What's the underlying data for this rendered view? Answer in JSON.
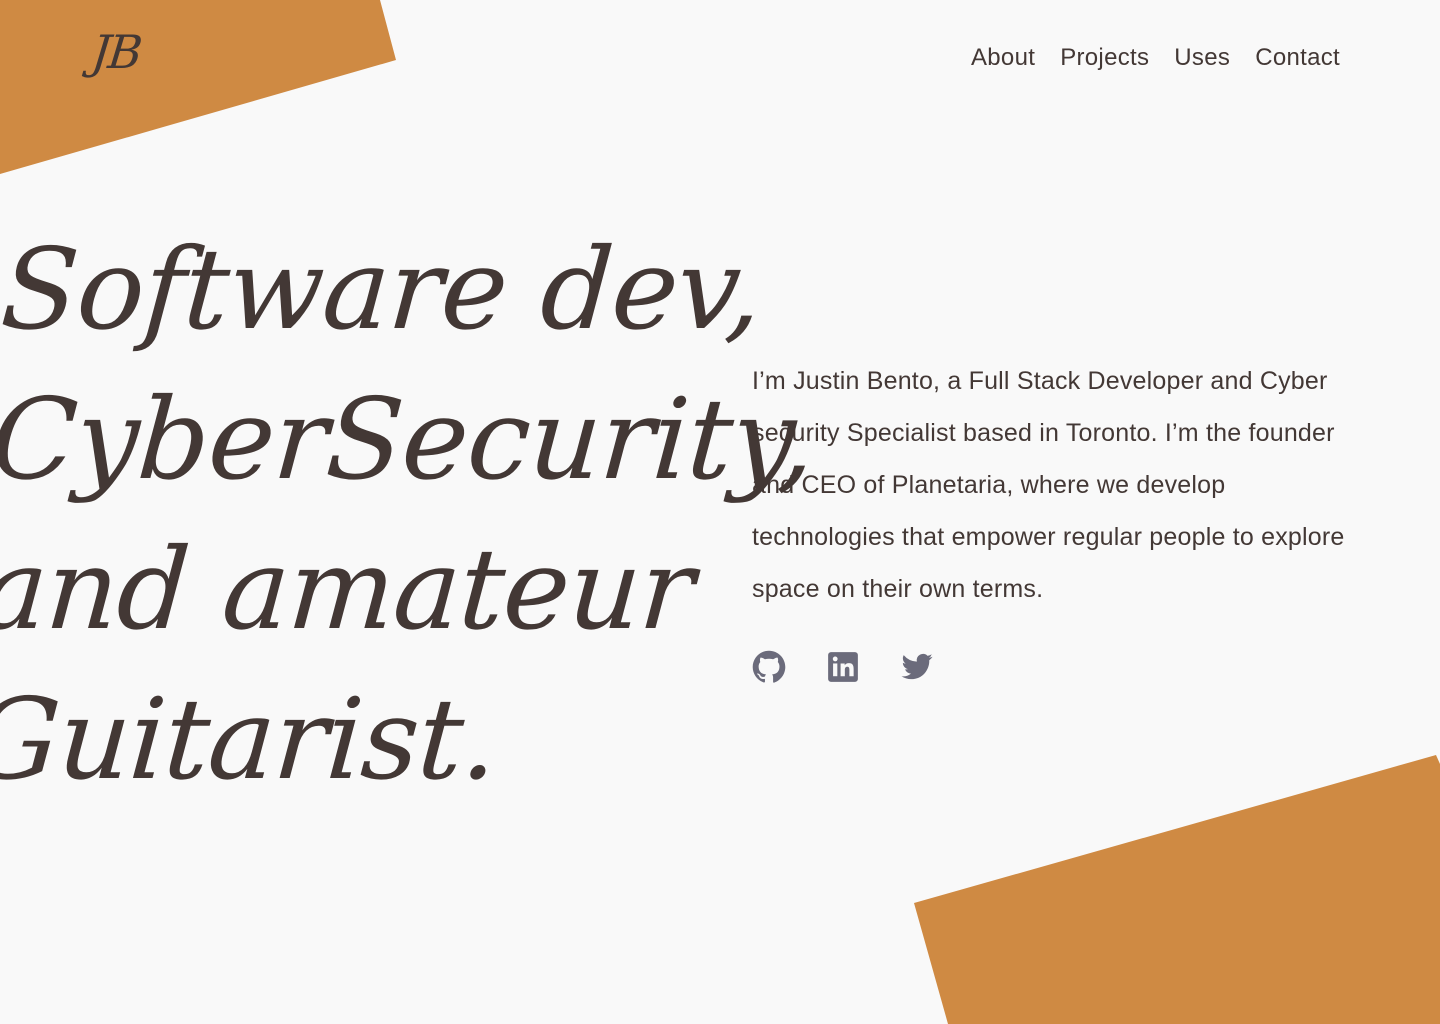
{
  "brand": {
    "logo_text": "JB",
    "accent_color": "#cf8a43",
    "text_color": "#433835",
    "icon_color": "#6b6b7b",
    "background_color": "#f9f9f9"
  },
  "nav": {
    "items": [
      {
        "label": "About"
      },
      {
        "label": "Projects"
      },
      {
        "label": "Uses"
      },
      {
        "label": "Contact"
      }
    ]
  },
  "hero": {
    "headline_lines": [
      "Software dev,",
      "CyberSecurity,",
      "and amateur",
      "Guitarist."
    ],
    "bio": "I’m Justin Bento, a Full Stack Developer and Cyber security Specialist based in Toronto. I’m the founder and CEO of Planetaria, where we develop technologies that empower regular people to explore space on their own terms."
  },
  "socials": [
    {
      "icon": "github-icon"
    },
    {
      "icon": "linkedin-icon"
    },
    {
      "icon": "twitter-icon"
    }
  ]
}
